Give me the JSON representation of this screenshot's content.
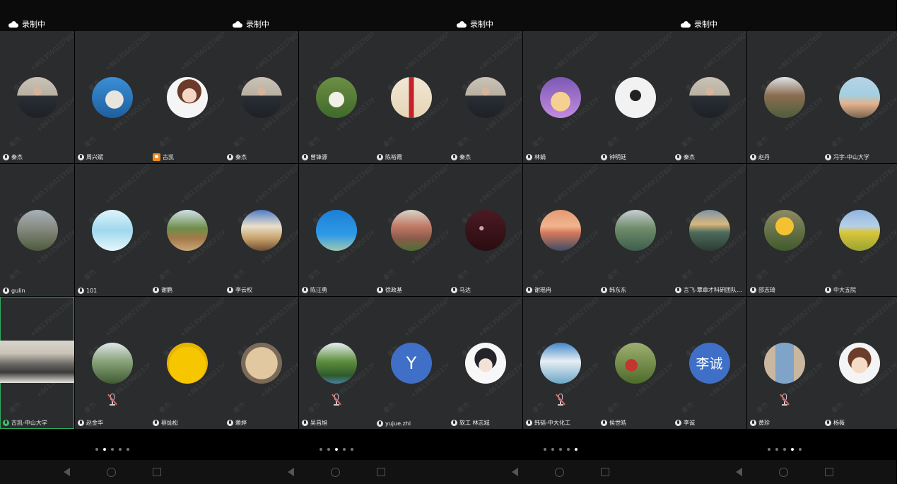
{
  "recording_label": "录制中",
  "watermark_name": "秦杰",
  "watermark_number": "+8613560237601",
  "colors": {
    "accent_active": "#2faa5a",
    "tile_bg": "#2b2c2e",
    "avatar_letter_bg": "#3f6fc6"
  },
  "panels": [
    {
      "page_count": 5,
      "active_page": 1,
      "tiles": [
        {
          "name": "秦杰",
          "icon": "mic",
          "avatar": "photo-portrait"
        },
        {
          "name": "周兴斌",
          "icon": "mic",
          "avatar": "photo-seal"
        },
        {
          "name": "古凯",
          "icon": "orange-user",
          "avatar": "photo-cartoon-girl"
        },
        {
          "name": "gulin",
          "icon": "mic",
          "avatar": "photo-tree"
        },
        {
          "name": "101",
          "icon": "mic",
          "avatar": "photo-sketch"
        },
        {
          "name": "谢鹏",
          "icon": "mic",
          "avatar": "photo-palm"
        },
        {
          "name": "古凯-中山大学",
          "icon": "mic-green",
          "avatar": "video-meeting",
          "active": true
        },
        {
          "name": "赵金华",
          "icon": "mic",
          "avatar": "photo-path",
          "muted": true
        },
        {
          "name": "蔡灿松",
          "icon": "mic",
          "avatar": "emoji-duck"
        }
      ]
    },
    {
      "page_count": 5,
      "active_page": 2,
      "tiles": [
        {
          "name": "秦杰",
          "icon": "mic",
          "avatar": "photo-portrait"
        },
        {
          "name": "曾锋源",
          "icon": "mic",
          "avatar": "photo-cat"
        },
        {
          "name": "陈裕霞",
          "icon": "mic",
          "avatar": "photo-gift"
        },
        {
          "name": "李云权",
          "icon": "mic",
          "avatar": "photo-umbrella"
        },
        {
          "name": "陈汪勇",
          "icon": "mic",
          "avatar": "photo-flag"
        },
        {
          "name": "徐政基",
          "icon": "mic",
          "avatar": "photo-building"
        },
        {
          "name": "赖婷",
          "icon": "mic",
          "avatar": "photo-rainbow"
        },
        {
          "name": "吴昌旭",
          "icon": "mic",
          "avatar": "photo-pond",
          "muted": true
        },
        {
          "name": "yujue.zhi",
          "icon": "mic",
          "avatar": "letter",
          "letter": "Y"
        }
      ]
    },
    {
      "page_count": 5,
      "active_page": 4,
      "tiles": [
        {
          "name": "秦杰",
          "icon": "mic",
          "avatar": "photo-portrait"
        },
        {
          "name": "林娟",
          "icon": "mic",
          "avatar": "photo-hamster"
        },
        {
          "name": "钟明廷",
          "icon": "mic",
          "avatar": "photo-dancer"
        },
        {
          "name": "马达",
          "icon": "mic",
          "avatar": "photo-dark-red"
        },
        {
          "name": "谢瑶冉",
          "icon": "mic",
          "avatar": "photo-sunset"
        },
        {
          "name": "韩东东",
          "icon": "mic",
          "avatar": "photo-river"
        },
        {
          "name": "软工 林志城",
          "icon": "mic",
          "avatar": "photo-anime"
        },
        {
          "name": "韩韬-中大化工",
          "icon": "mic",
          "avatar": "photo-sky",
          "muted": true
        },
        {
          "name": "侯世皓",
          "icon": "mic",
          "avatar": "photo-person-green"
        }
      ]
    },
    {
      "page_count": 5,
      "active_page": 3,
      "tiles": [
        {
          "name": "秦杰",
          "icon": "mic",
          "avatar": "photo-portrait"
        },
        {
          "name": "赵丹",
          "icon": "mic",
          "avatar": "photo-tower"
        },
        {
          "name": "冯宇-中山大学",
          "icon": "mic",
          "avatar": "photo-beach"
        },
        {
          "name": "言飞-覃章才科研团队...",
          "icon": "mic",
          "avatar": "photo-coast"
        },
        {
          "name": "邵志琦",
          "icon": "mic",
          "avatar": "photo-flowers"
        },
        {
          "name": "中大五院",
          "icon": "mic",
          "avatar": "photo-field"
        },
        {
          "name": "李诚",
          "icon": "mic",
          "avatar": "letter",
          "letter": "李诚"
        },
        {
          "name": "黄珍",
          "icon": "mic",
          "avatar": "photo-arch",
          "muted": true
        },
        {
          "name": "杨薇",
          "icon": "mic",
          "avatar": "photo-cartoon-glasses"
        }
      ]
    }
  ]
}
